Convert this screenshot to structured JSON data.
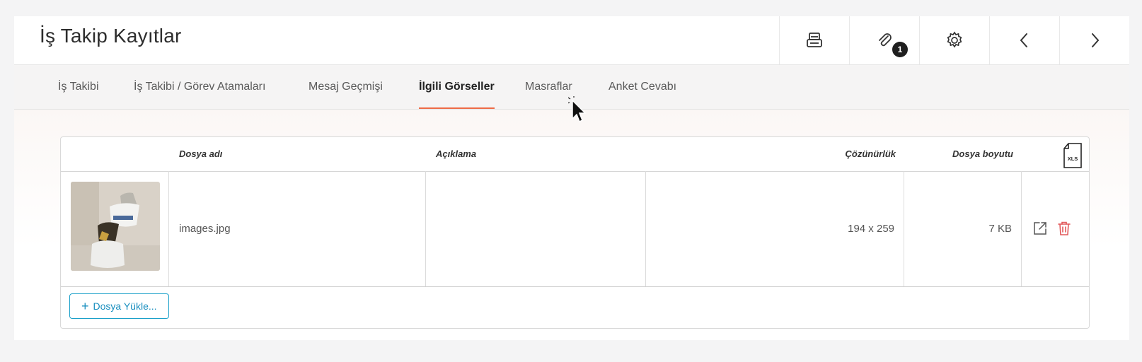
{
  "header": {
    "title": "İş Takip Kayıtlar",
    "attachment_count": "1"
  },
  "tabs": [
    {
      "label": "İş Takibi"
    },
    {
      "label": "İş Takibi / Görev Atamaları"
    },
    {
      "label": "Mesaj Geçmişi"
    },
    {
      "label": "İlgili Görseller",
      "active": true
    },
    {
      "label": "Masraflar"
    },
    {
      "label": "Anket Cevabı"
    }
  ],
  "grid": {
    "columns": {
      "filename": "Dosya adı",
      "description": "Açıklama",
      "resolution": "Çözünürlük",
      "size": "Dosya boyutu",
      "export_icon_text": "XLS"
    },
    "rows": [
      {
        "filename": "images.jpg",
        "description": "",
        "resolution": "194 x 259",
        "size": "7 KB"
      }
    ],
    "upload_label": "Dosya Yükle..."
  },
  "icons": {
    "print": "printer-icon",
    "attach": "paperclip-icon",
    "settings": "gear-icon",
    "prev": "chevron-left-icon",
    "next": "chevron-right-icon",
    "export": "xls-file-icon",
    "open": "external-link-icon",
    "delete": "trash-icon"
  },
  "colors": {
    "accent": "#ee6a45",
    "primary": "#1aa0c9",
    "danger": "#e2585a"
  }
}
